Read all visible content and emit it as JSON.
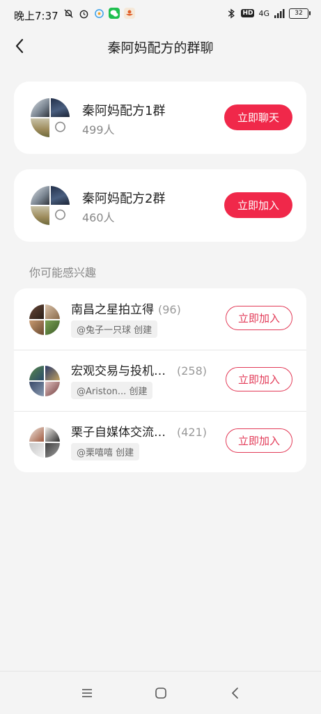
{
  "status_bar": {
    "time": "晚上7:37",
    "network": "4G",
    "battery": "32"
  },
  "header": {
    "title": "秦阿妈配方的群聊"
  },
  "joined_groups": [
    {
      "name": "秦阿妈配方1群",
      "count": "499人",
      "button": "立即聊天"
    },
    {
      "name": "秦阿妈配方2群",
      "count": "460人",
      "button": "立即加入"
    }
  ],
  "suggestions": {
    "label": "你可能感兴趣",
    "items": [
      {
        "name": "南昌之星拍立得",
        "count": "(96)",
        "creator": "@兔子一只球 创建",
        "button": "立即加入"
      },
      {
        "name": "宏观交易与投机…",
        "count": "(258)",
        "creator": "@Ariston... 创建",
        "button": "立即加入"
      },
      {
        "name": "栗子自媒体交流…",
        "count": "(421)",
        "creator": "@栗嘻嘻 创建",
        "button": "立即加入"
      }
    ]
  },
  "colors": {
    "accent": "#f0284a",
    "background": "#f4f4f4",
    "card": "#ffffff"
  },
  "icons": [
    "do-not-disturb-icon",
    "alarm-icon",
    "chat-app-icon",
    "wechat-icon",
    "app-notification-icon",
    "bluetooth-icon",
    "signal-icon",
    "battery-icon",
    "back-icon",
    "menu-icon",
    "home-icon",
    "back-nav-icon"
  ]
}
